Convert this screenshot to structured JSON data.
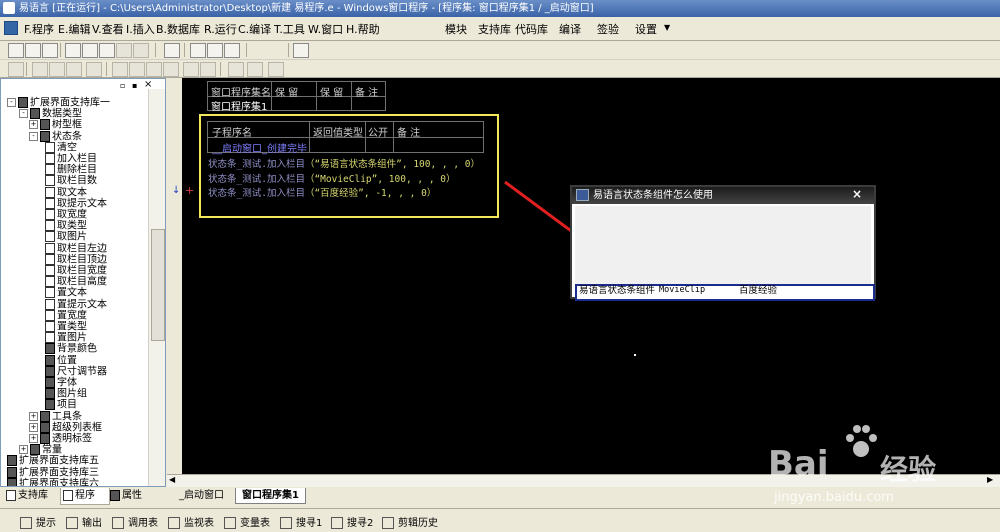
{
  "window": {
    "title": "易语言 [正在运行] - C:\\Users\\Administrator\\Desktop\\新建 易程序.e - Windows窗口程序 - [程序集: 窗口程序集1 / _启动窗口]"
  },
  "menu": {
    "items": [
      "F.程序",
      "E.编辑",
      "V.查看",
      "I.插入",
      "B.数据库",
      "R.运行",
      "C.编译",
      "T.工具",
      "W.窗口",
      "H.帮助"
    ],
    "right_items": [
      "模块",
      "支持库",
      "代码库",
      "编译",
      "签验",
      "设置"
    ]
  },
  "tree": [
    {
      "label": "扩展界面支持库一",
      "depth": 0,
      "expander": "-",
      "icon": "lib"
    },
    {
      "label": "数据类型",
      "depth": 1,
      "expander": "-",
      "icon": "group"
    },
    {
      "label": "树型框",
      "depth": 2,
      "expander": "+",
      "icon": "group"
    },
    {
      "label": "状态条",
      "depth": 2,
      "expander": "-",
      "icon": "group"
    },
    {
      "label": "清空",
      "depth": 3,
      "expander": "",
      "icon": "method"
    },
    {
      "label": "加入栏目",
      "depth": 3,
      "expander": "",
      "icon": "method"
    },
    {
      "label": "删除栏目",
      "depth": 3,
      "expander": "",
      "icon": "method"
    },
    {
      "label": "取栏目数",
      "depth": 3,
      "expander": "",
      "icon": "method"
    },
    {
      "label": "取文本",
      "depth": 3,
      "expander": "",
      "icon": "method"
    },
    {
      "label": "取提示文本",
      "depth": 3,
      "expander": "",
      "icon": "method"
    },
    {
      "label": "取宽度",
      "depth": 3,
      "expander": "",
      "icon": "method"
    },
    {
      "label": "取类型",
      "depth": 3,
      "expander": "",
      "icon": "method"
    },
    {
      "label": "取图片",
      "depth": 3,
      "expander": "",
      "icon": "method"
    },
    {
      "label": "取栏目左边",
      "depth": 3,
      "expander": "",
      "icon": "method"
    },
    {
      "label": "取栏目顶边",
      "depth": 3,
      "expander": "",
      "icon": "method"
    },
    {
      "label": "取栏目宽度",
      "depth": 3,
      "expander": "",
      "icon": "method"
    },
    {
      "label": "取栏目高度",
      "depth": 3,
      "expander": "",
      "icon": "method"
    },
    {
      "label": "置文本",
      "depth": 3,
      "expander": "",
      "icon": "method"
    },
    {
      "label": "置提示文本",
      "depth": 3,
      "expander": "",
      "icon": "method"
    },
    {
      "label": "置宽度",
      "depth": 3,
      "expander": "",
      "icon": "method"
    },
    {
      "label": "置类型",
      "depth": 3,
      "expander": "",
      "icon": "method"
    },
    {
      "label": "置图片",
      "depth": 3,
      "expander": "",
      "icon": "method"
    },
    {
      "label": "背景颜色",
      "depth": 3,
      "expander": "",
      "icon": "prop"
    },
    {
      "label": "位置",
      "depth": 3,
      "expander": "",
      "icon": "prop"
    },
    {
      "label": "尺寸调节器",
      "depth": 3,
      "expander": "",
      "icon": "prop"
    },
    {
      "label": "字体",
      "depth": 3,
      "expander": "",
      "icon": "prop"
    },
    {
      "label": "图片组",
      "depth": 3,
      "expander": "",
      "icon": "prop"
    },
    {
      "label": "项目",
      "depth": 3,
      "expander": "",
      "icon": "prop"
    },
    {
      "label": "工具条",
      "depth": 2,
      "expander": "+",
      "icon": "group"
    },
    {
      "label": "超级列表框",
      "depth": 2,
      "expander": "+",
      "icon": "group"
    },
    {
      "label": "透明标签",
      "depth": 2,
      "expander": "+",
      "icon": "group"
    },
    {
      "label": "常量",
      "depth": 1,
      "expander": "+",
      "icon": "group"
    },
    {
      "label": "扩展界面支持库五",
      "depth": 0,
      "expander": "",
      "icon": "lib"
    },
    {
      "label": "扩展界面支持库三",
      "depth": 0,
      "expander": "",
      "icon": "lib"
    },
    {
      "label": "扩展界面支持库六",
      "depth": 0,
      "expander": "",
      "icon": "lib"
    }
  ],
  "left_tabs": [
    "支持库",
    "程序",
    "属性"
  ],
  "editor": {
    "assembly_table": {
      "headers": [
        "窗口程序集名",
        "保 留",
        "保 留",
        "备 注"
      ],
      "row": [
        "窗口程序集1",
        "",
        "",
        ""
      ]
    },
    "sub_table": {
      "headers": [
        "子程序名",
        "返回值类型",
        "公开",
        "备 注"
      ],
      "row": [
        "__启动窗口_创建完毕",
        "",
        "",
        ""
      ]
    },
    "code_lines": [
      {
        "prefix": "状态条_测试.加入栏目",
        "args": "（“易语言状态条组件”, 100, , , 0）"
      },
      {
        "prefix": "状态条_测试.加入栏目",
        "args": "（“MovieClip”, 100, , , 0）"
      },
      {
        "prefix": "状态条_测试.加入栏目",
        "args": "（“百度经验”, -1, , , 0）"
      }
    ],
    "gutter_marks": [
      "↓",
      "+"
    ]
  },
  "doc_tabs": [
    "_启动窗口",
    "窗口程序集1"
  ],
  "popup": {
    "title": "易语言状态条组件怎么使用",
    "close": "×",
    "status_cells": [
      "易语言状态条组件",
      "MovieClip",
      "百度经验"
    ]
  },
  "bottom_tabs": [
    "提示",
    "输出",
    "调用表",
    "监视表",
    "变量表",
    "搜寻1",
    "搜寻2",
    "剪辑历史"
  ],
  "watermark": {
    "brand": "Bai",
    "brand2": "经验",
    "url": "jingyan.baidu.com"
  },
  "colors": {
    "highlight_box": "#f2e85a",
    "arrow": "#e02020",
    "keyword_blue": "#7f7fff",
    "string_yellow": "#e0e070"
  }
}
